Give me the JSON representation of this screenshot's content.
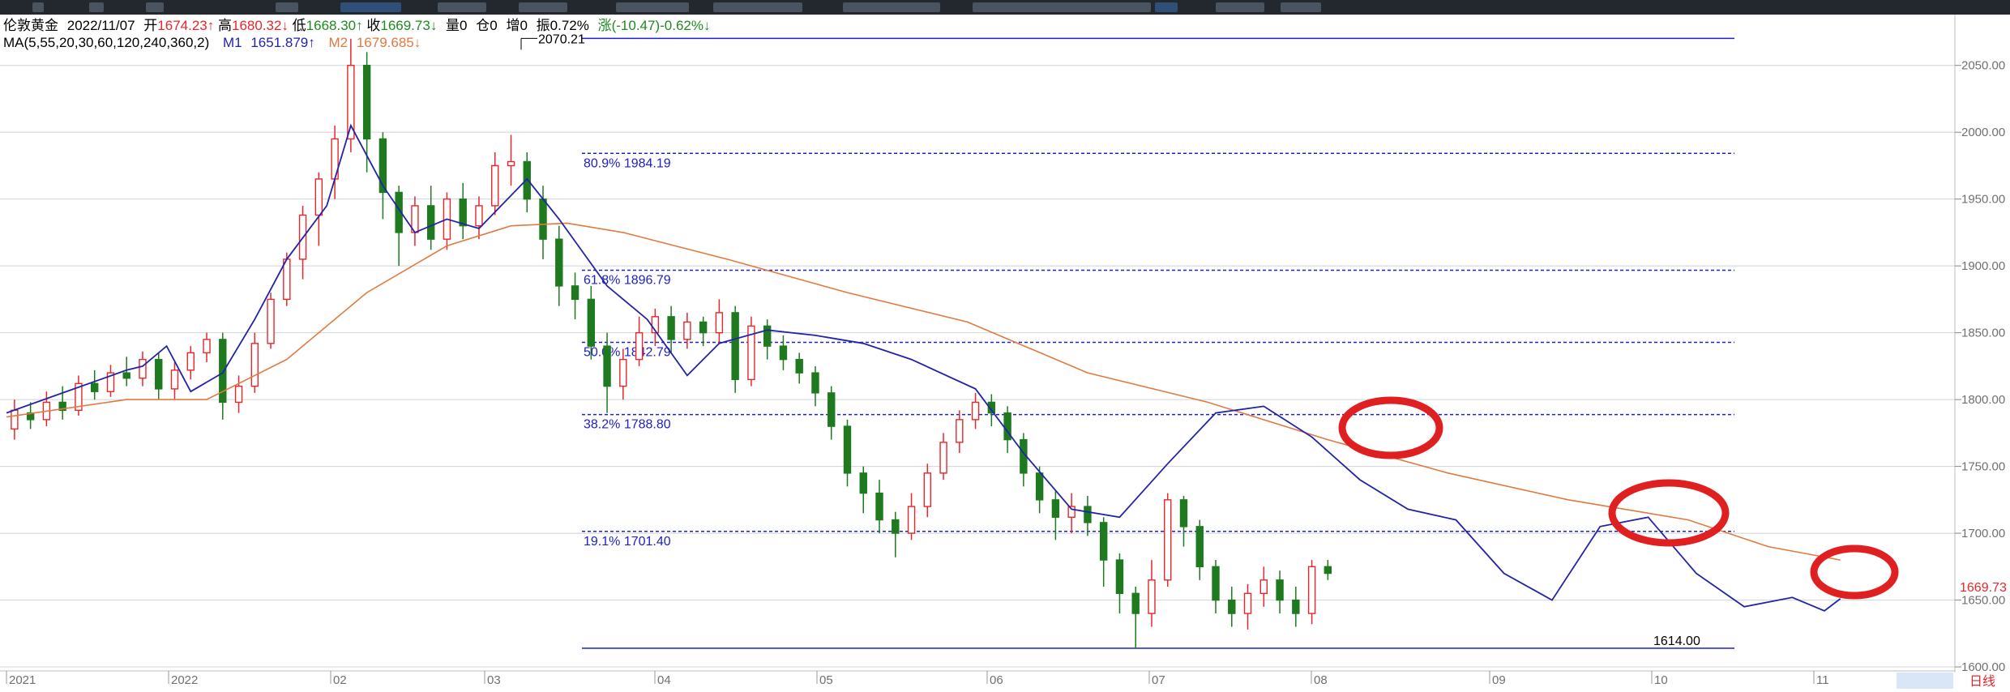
{
  "header": {
    "name": "伦敦黄金",
    "date": "2022/11/07",
    "open_label": "开",
    "open": "1674.23",
    "open_arrow": "↑",
    "high_label": "高",
    "high": "1680.32",
    "high_arrow": "↓",
    "low_label": "低",
    "low": "1668.30",
    "low_arrow": "↑",
    "close_label": "收",
    "close": "1669.73",
    "close_arrow": "↓",
    "volume": "量0",
    "position": "仓0",
    "increase": "增0",
    "amplitude": "振0.72%",
    "change": "涨(-10.47)-0.62%↓",
    "ma_params": "MA(5,55,20,30,60,120,240,360,2)",
    "m1_label": "M1",
    "m1": "1651.879",
    "m1_arrow": "↑",
    "m2_label": "M2",
    "m2": "1679.685",
    "m2_arrow": "↓"
  },
  "colors": {
    "up": "#e8262b",
    "down": "#1f7a1f",
    "ma1": "#2323a8",
    "ma2": "#e07a40",
    "fib": "#2020c8",
    "circle": "#e02020",
    "grid": "#cfd3d8",
    "axis_text": "#707070",
    "price_tag": "#e8262b"
  },
  "chart_data": {
    "type": "candlestick",
    "y_range": [
      1597,
      2088
    ],
    "y_ticks": [
      "1600.00",
      "1650.00",
      "1700.00",
      "1750.00",
      "1800.00",
      "1850.00",
      "1900.00",
      "1950.00",
      "2000.00",
      "2050.00"
    ],
    "x_labels": [
      "2021",
      "2022",
      "02",
      "03",
      "04",
      "05",
      "06",
      "07",
      "08",
      "09",
      "10",
      "11"
    ],
    "x_axis_note": "日线",
    "current_price": "1669.73",
    "fib_levels": [
      {
        "label": "80.9% 1984.19",
        "value": 1984.19
      },
      {
        "label": "61.8% 1896.79",
        "value": 1896.79
      },
      {
        "label": "50.0% 1842.79",
        "value": 1842.79
      },
      {
        "label": "38.2% 1788.80",
        "value": 1788.8
      },
      {
        "label": "19.1% 1701.40",
        "value": 1701.4
      }
    ],
    "fib_high": {
      "label": "2070.21",
      "value": 2070.21
    },
    "fib_low": {
      "label": "1614.00",
      "value": 1614.0
    },
    "ma1_approx": [
      [
        2021.95,
        1790
      ],
      [
        2022.02,
        1805
      ],
      [
        2022.1,
        1822
      ],
      [
        2022.12,
        1825
      ],
      [
        2022.15,
        1840
      ],
      [
        2022.18,
        1806
      ],
      [
        2022.22,
        1820
      ],
      [
        2022.26,
        1860
      ],
      [
        2022.3,
        1905
      ],
      [
        2022.35,
        1945
      ],
      [
        2022.38,
        2005
      ],
      [
        2022.42,
        1960
      ],
      [
        2022.46,
        1925
      ],
      [
        2022.5,
        1935
      ],
      [
        2022.54,
        1928
      ],
      [
        2022.6,
        1965
      ],
      [
        2022.64,
        1935
      ],
      [
        2022.7,
        1885
      ],
      [
        2022.75,
        1860
      ],
      [
        2022.8,
        1818
      ],
      [
        2022.84,
        1842
      ],
      [
        2022.9,
        1852
      ],
      [
        2022.96,
        1848
      ],
      [
        2023.02,
        1842
      ],
      [
        2023.08,
        1830
      ],
      [
        2023.16,
        1808
      ],
      [
        2023.22,
        1760
      ],
      [
        2023.28,
        1718
      ],
      [
        2023.34,
        1712
      ],
      [
        2023.4,
        1752
      ],
      [
        2023.46,
        1790
      ],
      [
        2023.52,
        1795
      ],
      [
        2023.58,
        1772
      ],
      [
        2023.64,
        1740
      ],
      [
        2023.7,
        1718
      ],
      [
        2023.76,
        1710
      ],
      [
        2023.82,
        1670
      ],
      [
        2023.88,
        1650
      ],
      [
        2023.94,
        1705
      ],
      [
        2024.0,
        1712
      ],
      [
        2024.06,
        1670
      ],
      [
        2024.12,
        1645
      ],
      [
        2024.18,
        1652
      ],
      [
        2024.22,
        1642
      ],
      [
        2024.24,
        1651
      ]
    ],
    "ma2_approx": [
      [
        2021.95,
        1787
      ],
      [
        2022.1,
        1800
      ],
      [
        2022.2,
        1800
      ],
      [
        2022.3,
        1830
      ],
      [
        2022.4,
        1880
      ],
      [
        2022.5,
        1915
      ],
      [
        2022.58,
        1930
      ],
      [
        2022.65,
        1932
      ],
      [
        2022.72,
        1925
      ],
      [
        2022.85,
        1905
      ],
      [
        2023.0,
        1880
      ],
      [
        2023.15,
        1858
      ],
      [
        2023.3,
        1820
      ],
      [
        2023.45,
        1798
      ],
      [
        2023.6,
        1770
      ],
      [
        2023.75,
        1745
      ],
      [
        2023.9,
        1725
      ],
      [
        2024.05,
        1710
      ],
      [
        2024.15,
        1690
      ],
      [
        2024.24,
        1680
      ]
    ],
    "candles_approx": [
      [
        2021.96,
        1778,
        1792,
        1800,
        1770
      ],
      [
        2021.98,
        1790,
        1785,
        1798,
        1778
      ],
      [
        2022.0,
        1785,
        1798,
        1806,
        1780
      ],
      [
        2022.02,
        1798,
        1792,
        1810,
        1785
      ],
      [
        2022.04,
        1792,
        1812,
        1818,
        1788
      ],
      [
        2022.06,
        1812,
        1806,
        1822,
        1800
      ],
      [
        2022.08,
        1806,
        1820,
        1826,
        1802
      ],
      [
        2022.1,
        1820,
        1816,
        1832,
        1810
      ],
      [
        2022.12,
        1816,
        1830,
        1836,
        1810
      ],
      [
        2022.14,
        1830,
        1808,
        1835,
        1800
      ],
      [
        2022.16,
        1808,
        1822,
        1828,
        1800
      ],
      [
        2022.18,
        1822,
        1835,
        1840,
        1815
      ],
      [
        2022.2,
        1835,
        1845,
        1850,
        1828
      ],
      [
        2022.22,
        1845,
        1798,
        1850,
        1785
      ],
      [
        2022.24,
        1798,
        1810,
        1818,
        1790
      ],
      [
        2022.26,
        1810,
        1842,
        1850,
        1805
      ],
      [
        2022.28,
        1842,
        1875,
        1880,
        1838
      ],
      [
        2022.3,
        1875,
        1905,
        1910,
        1870
      ],
      [
        2022.32,
        1905,
        1938,
        1945,
        1890
      ],
      [
        2022.34,
        1938,
        1965,
        1970,
        1915
      ],
      [
        2022.36,
        1965,
        1995,
        2005,
        1950
      ],
      [
        2022.38,
        1995,
        2050,
        2070,
        1985
      ],
      [
        2022.4,
        2050,
        1995,
        2060,
        1970
      ],
      [
        2022.42,
        1995,
        1955,
        2000,
        1935
      ],
      [
        2022.44,
        1955,
        1925,
        1960,
        1900
      ],
      [
        2022.46,
        1925,
        1945,
        1952,
        1915
      ],
      [
        2022.48,
        1945,
        1920,
        1960,
        1912
      ],
      [
        2022.5,
        1920,
        1950,
        1955,
        1912
      ],
      [
        2022.52,
        1950,
        1930,
        1962,
        1920
      ],
      [
        2022.54,
        1930,
        1945,
        1952,
        1920
      ],
      [
        2022.56,
        1945,
        1975,
        1985,
        1938
      ],
      [
        2022.58,
        1975,
        1978,
        1998,
        1960
      ],
      [
        2022.6,
        1978,
        1950,
        1985,
        1940
      ],
      [
        2022.62,
        1950,
        1920,
        1960,
        1905
      ],
      [
        2022.64,
        1920,
        1885,
        1930,
        1870
      ],
      [
        2022.66,
        1885,
        1875,
        1895,
        1860
      ],
      [
        2022.68,
        1875,
        1840,
        1885,
        1830
      ],
      [
        2022.7,
        1840,
        1810,
        1850,
        1790
      ],
      [
        2022.72,
        1810,
        1830,
        1838,
        1800
      ],
      [
        2022.74,
        1830,
        1850,
        1862,
        1825
      ],
      [
        2022.76,
        1850,
        1862,
        1868,
        1840
      ],
      [
        2022.78,
        1862,
        1845,
        1870,
        1835
      ],
      [
        2022.8,
        1845,
        1858,
        1865,
        1838
      ],
      [
        2022.82,
        1858,
        1850,
        1862,
        1840
      ],
      [
        2022.84,
        1850,
        1865,
        1875,
        1842
      ],
      [
        2022.86,
        1865,
        1815,
        1870,
        1805
      ],
      [
        2022.88,
        1815,
        1855,
        1862,
        1810
      ],
      [
        2022.9,
        1855,
        1840,
        1860,
        1830
      ],
      [
        2022.92,
        1840,
        1830,
        1848,
        1822
      ],
      [
        2022.94,
        1830,
        1820,
        1835,
        1812
      ],
      [
        2022.96,
        1820,
        1805,
        1825,
        1795
      ],
      [
        2022.98,
        1805,
        1780,
        1810,
        1770
      ],
      [
        2023.0,
        1780,
        1745,
        1785,
        1735
      ],
      [
        2023.02,
        1745,
        1730,
        1750,
        1715
      ],
      [
        2023.04,
        1730,
        1710,
        1740,
        1700
      ],
      [
        2023.06,
        1710,
        1700,
        1716,
        1682
      ],
      [
        2023.08,
        1700,
        1720,
        1730,
        1695
      ],
      [
        2023.1,
        1720,
        1745,
        1752,
        1712
      ],
      [
        2023.12,
        1745,
        1768,
        1775,
        1740
      ],
      [
        2023.14,
        1768,
        1785,
        1792,
        1760
      ],
      [
        2023.16,
        1785,
        1798,
        1805,
        1778
      ],
      [
        2023.18,
        1798,
        1790,
        1804,
        1780
      ],
      [
        2023.2,
        1790,
        1770,
        1795,
        1760
      ],
      [
        2023.22,
        1770,
        1745,
        1775,
        1735
      ],
      [
        2023.24,
        1745,
        1725,
        1750,
        1715
      ],
      [
        2023.26,
        1725,
        1712,
        1732,
        1695
      ],
      [
        2023.28,
        1712,
        1720,
        1730,
        1700
      ],
      [
        2023.3,
        1720,
        1708,
        1728,
        1698
      ],
      [
        2023.32,
        1708,
        1680,
        1712,
        1660
      ],
      [
        2023.34,
        1680,
        1655,
        1685,
        1640
      ],
      [
        2023.36,
        1655,
        1640,
        1660,
        1614
      ],
      [
        2023.38,
        1640,
        1665,
        1680,
        1630
      ],
      [
        2023.4,
        1665,
        1725,
        1730,
        1660
      ],
      [
        2023.42,
        1725,
        1705,
        1728,
        1690
      ],
      [
        2023.44,
        1705,
        1675,
        1710,
        1665
      ],
      [
        2023.46,
        1675,
        1650,
        1680,
        1640
      ],
      [
        2023.48,
        1650,
        1640,
        1660,
        1630
      ],
      [
        2023.5,
        1640,
        1655,
        1662,
        1628
      ],
      [
        2023.52,
        1655,
        1665,
        1675,
        1645
      ],
      [
        2023.54,
        1665,
        1650,
        1672,
        1640
      ],
      [
        2023.56,
        1650,
        1640,
        1660,
        1630
      ],
      [
        2023.58,
        1640,
        1675,
        1680,
        1632
      ],
      [
        2023.6,
        1675,
        1670,
        1680,
        1665
      ]
    ]
  }
}
